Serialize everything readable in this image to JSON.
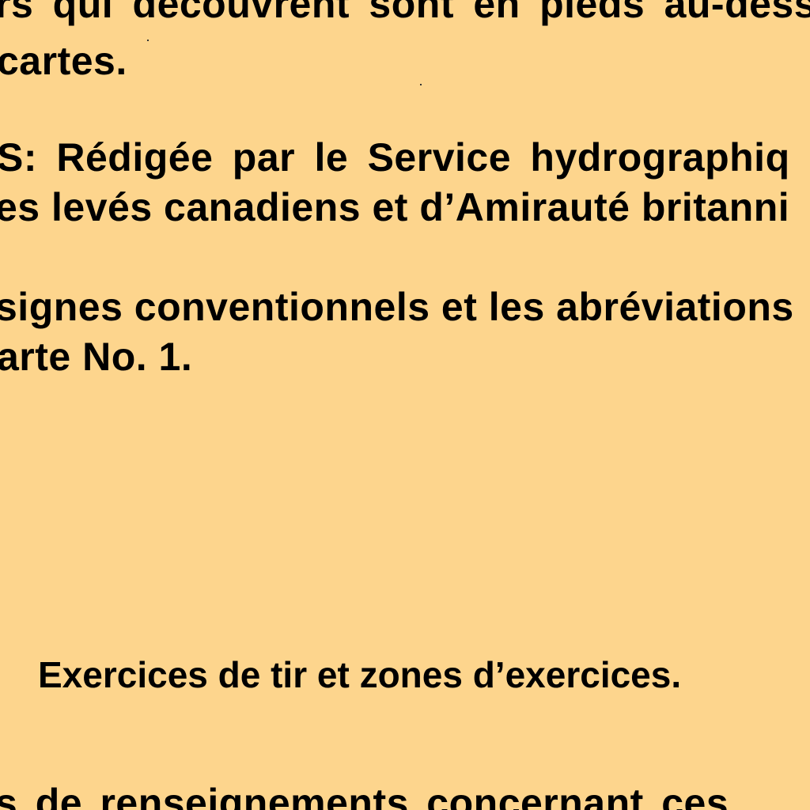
{
  "document": {
    "lines": [
      "rs qui découvrent sont en pieds au-dess",
      "cartes.",
      "S: Rédigée par le Service hydrographiq",
      "es levés canadiens et d’Amirauté britanni",
      "signes conventionnels et les abréviations",
      "arte No. 1.",
      "Exercices de tir et zones d’exercices.",
      "s de renseignements concernant ces"
    ]
  },
  "colors": {
    "background": "#fdd58d",
    "text": "#000000"
  }
}
